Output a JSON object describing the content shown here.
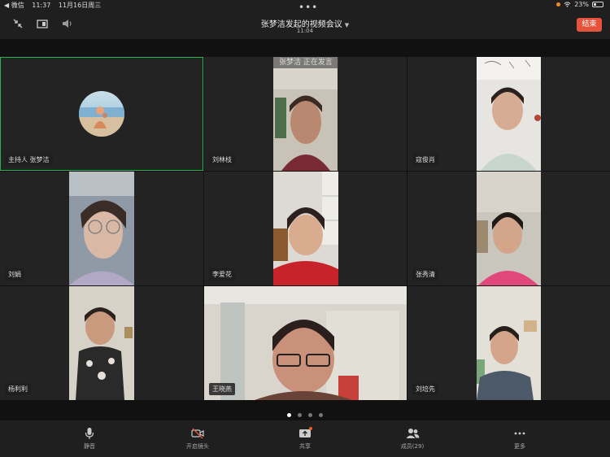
{
  "status_bar": {
    "back_label": "◀ 微信",
    "time": "11:37",
    "date": "11月16日周三",
    "battery": "23%"
  },
  "header": {
    "title": "张梦洁发起的视频会议",
    "timer": "11:04",
    "end_label": "结束"
  },
  "speaking_banner": "张梦洁 正在发言",
  "participants": [
    {
      "label": "主持人  张梦洁"
    },
    {
      "label": "刘林枝"
    },
    {
      "label": "寇俊肖"
    },
    {
      "label": "刘娟"
    },
    {
      "label": "李爱花"
    },
    {
      "label": "张秀清"
    },
    {
      "label": "杨利利"
    },
    {
      "label": "王晓燕"
    },
    {
      "label": "刘培先"
    }
  ],
  "pagination": {
    "pages": 4,
    "current": 1
  },
  "toolbar": {
    "mute": "静音",
    "camera": "开启镜头",
    "share": "共享",
    "members": "成员(29)",
    "more": "更多"
  },
  "colors": {
    "accent_end": "#e5533d",
    "active_speaker_border": "#29b34a"
  }
}
